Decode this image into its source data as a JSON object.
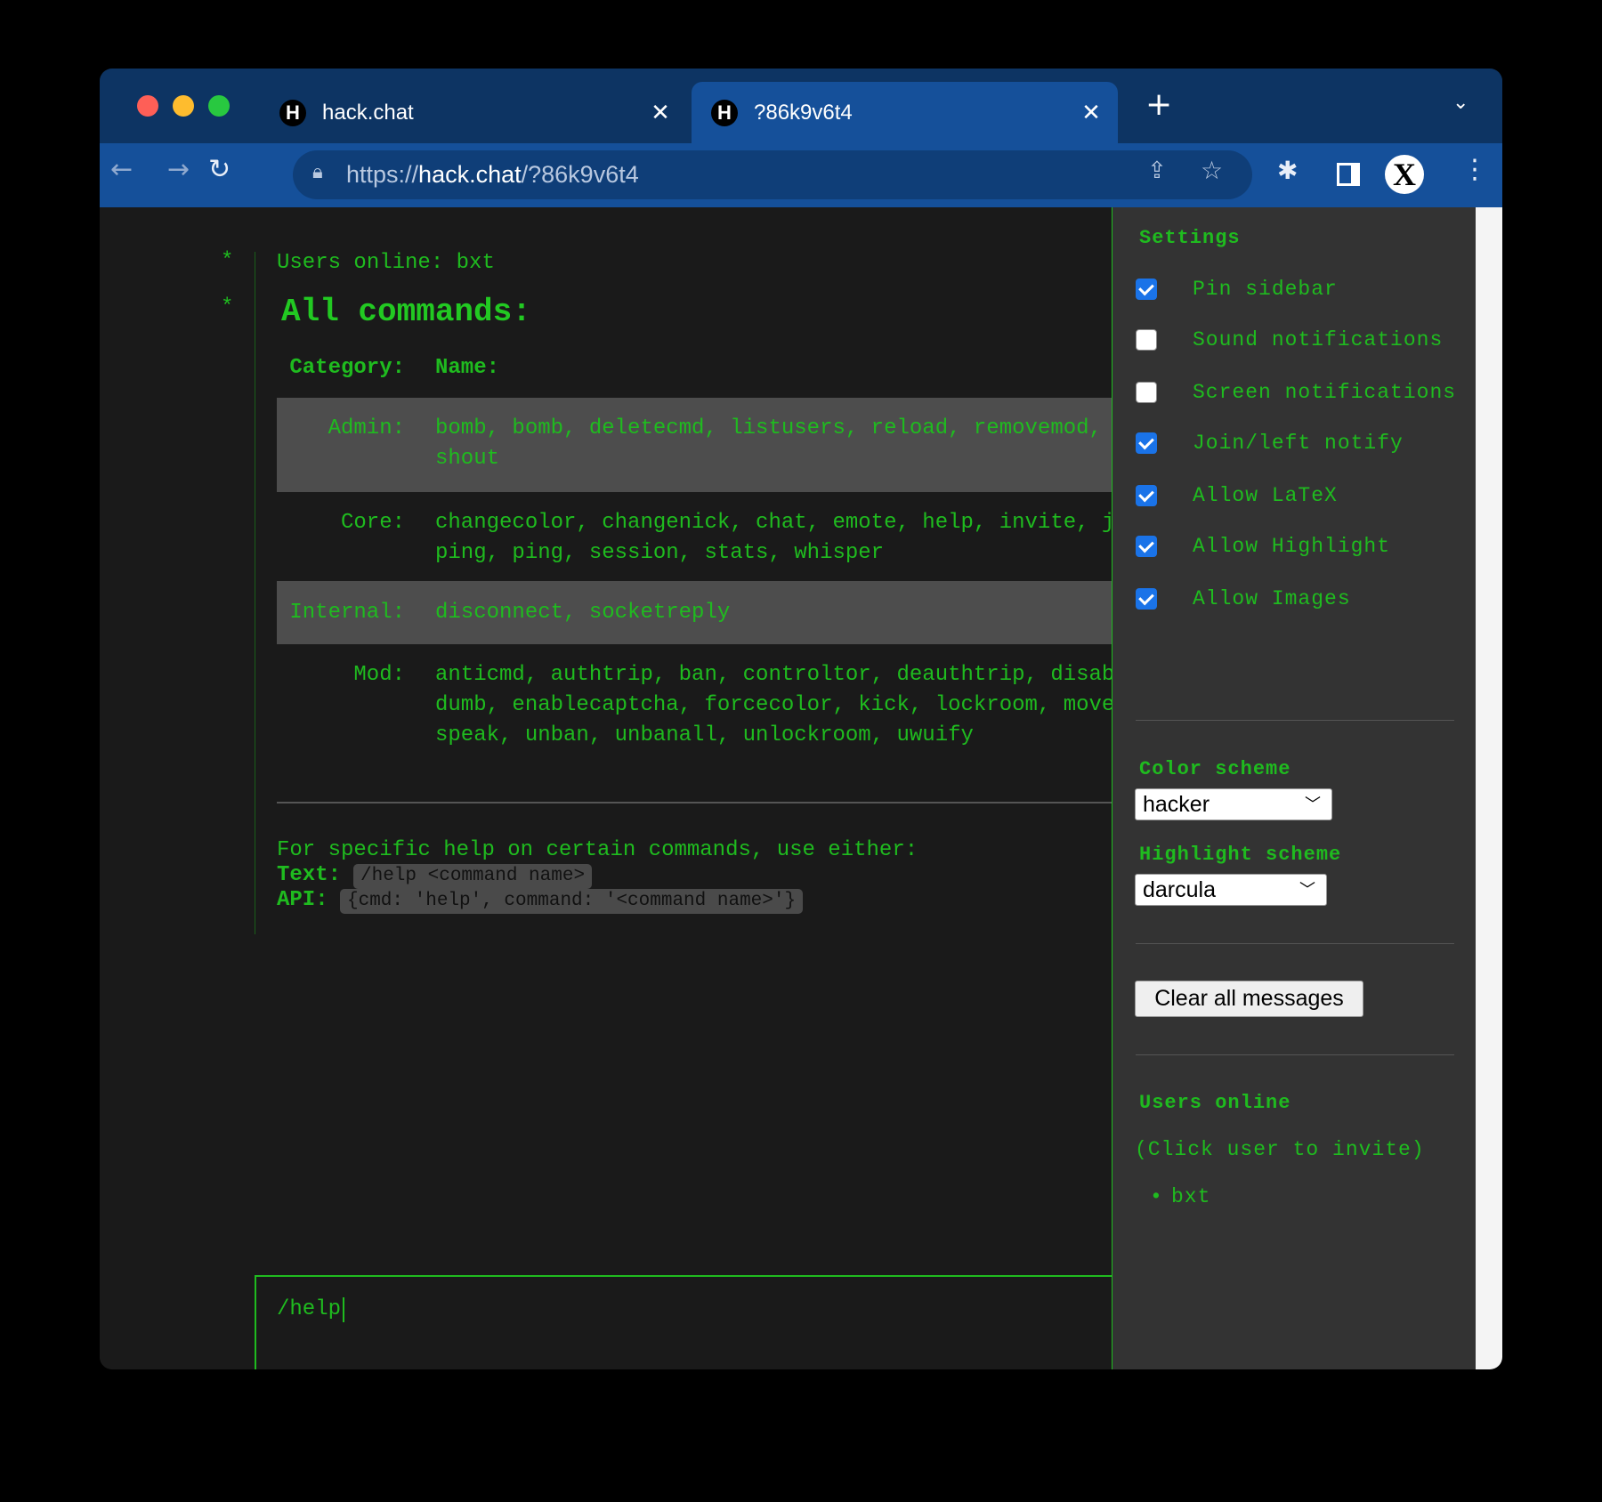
{
  "browser": {
    "tabs": [
      {
        "title": "hack.chat",
        "favicon": "H",
        "active": false
      },
      {
        "title": "?86k9v6t4",
        "favicon": "H",
        "active": true
      }
    ],
    "url_scheme": "https://",
    "url_host": "hack.chat",
    "url_path": "/?86k9v6t4",
    "profile_letter": "X",
    "colors": {
      "tabbar": "#0d3463",
      "toolbar": "#15509a"
    }
  },
  "chat": {
    "star": "*",
    "users_online_msg": "Users online: bxt",
    "heading": "All commands:",
    "col_category": "Category:",
    "col_name": "Name:",
    "rows": [
      {
        "category": "Admin:",
        "lines": [
          "bomb, bomb, deletecmd, listusers, reload, removemod,",
          "shout"
        ]
      },
      {
        "category": "Core:",
        "lines": [
          "changecolor, changenick, chat, emote, help, invite, j",
          "ping, ping, session, stats, whisper"
        ]
      },
      {
        "category": "Internal:",
        "lines": [
          "disconnect, socketreply"
        ]
      },
      {
        "category": "Mod:",
        "lines": [
          "anticmd, authtrip, ban, controltor, deauthtrip, disab",
          "dumb, enablecaptcha, forcecolor, kick, lockroom, move",
          "speak, unban, unbanall, unlockroom, uwuify"
        ]
      }
    ],
    "help_intro": "For specific help on certain commands, use either:",
    "text_label": "Text:",
    "text_code": "/help <command name>",
    "api_label": "API:",
    "api_code": "{cmd: 'help', command: '<command name>'}",
    "input_value": "/help",
    "accent": "#1fbb1f"
  },
  "sidebar": {
    "settings_title": "Settings",
    "options": [
      {
        "label": "Pin sidebar",
        "checked": true
      },
      {
        "label": "Sound notifications",
        "checked": false
      },
      {
        "label": "Screen notifications",
        "checked": false
      },
      {
        "label": "Join/left notify",
        "checked": true
      },
      {
        "label": "Allow LaTeX",
        "checked": true
      },
      {
        "label": "Allow Highlight",
        "checked": true
      },
      {
        "label": "Allow Images",
        "checked": true
      }
    ],
    "color_scheme_label": "Color scheme",
    "color_scheme_value": "hacker",
    "highlight_scheme_label": "Highlight scheme",
    "highlight_scheme_value": "darcula",
    "clear_button": "Clear all messages",
    "users_title": "Users online",
    "users_hint": "(Click user to invite)",
    "users": [
      "bxt"
    ]
  }
}
